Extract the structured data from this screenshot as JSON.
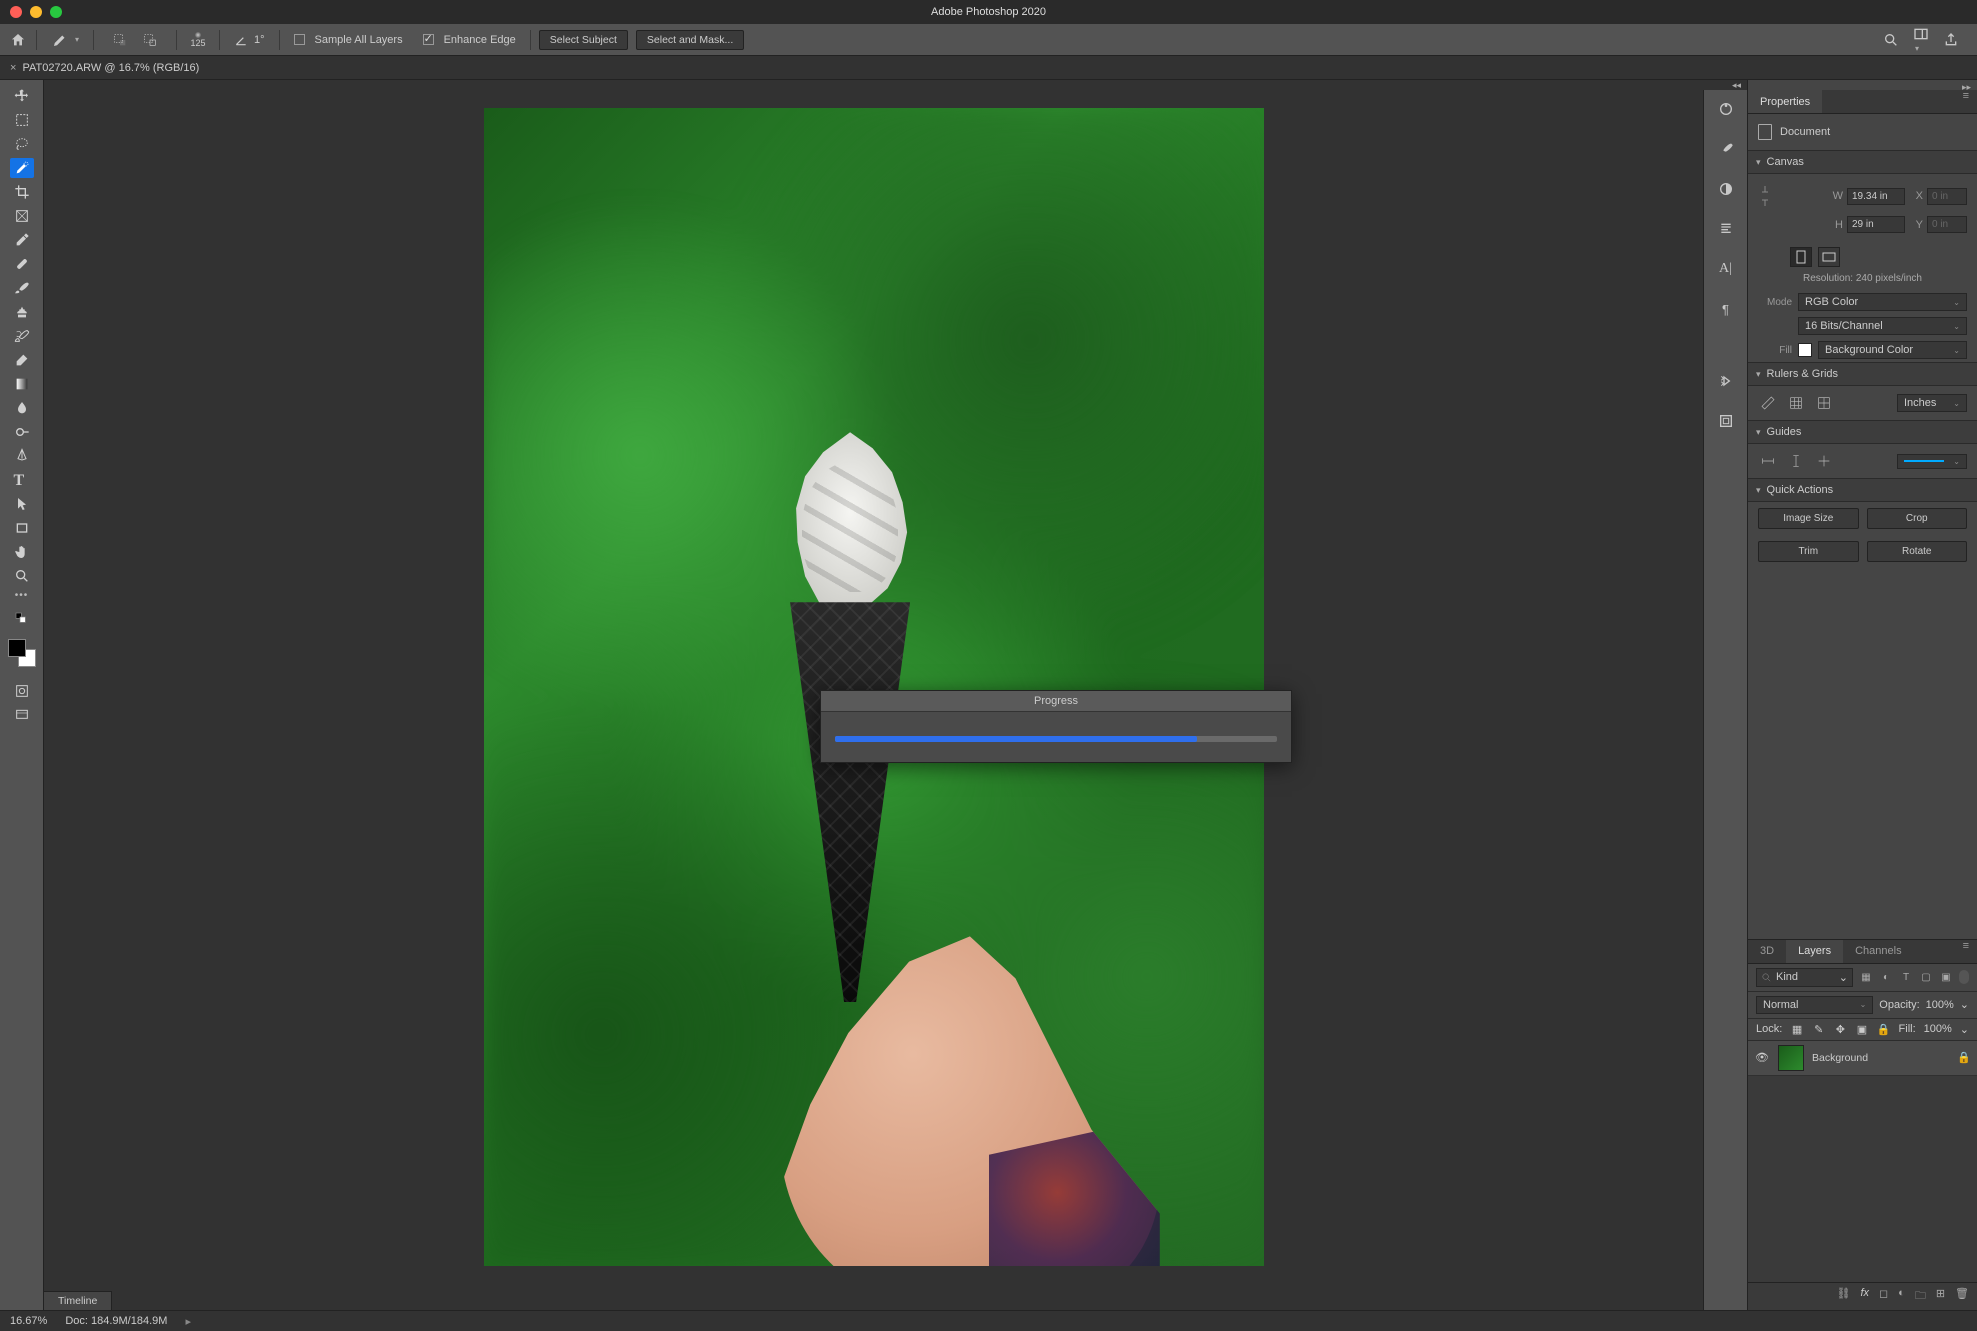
{
  "app_title": "Adobe Photoshop 2020",
  "document_tab": "PAT02720.ARW @ 16.7% (RGB/16)",
  "options_bar": {
    "brush_size": "125",
    "angle_label": "1°",
    "sample_all_layers": "Sample All Layers",
    "sample_all_layers_checked": false,
    "enhance_edge": "Enhance Edge",
    "enhance_edge_checked": true,
    "select_subject": "Select Subject",
    "select_and_mask": "Select and Mask..."
  },
  "progress_dialog": {
    "title": "Progress",
    "percent": 82
  },
  "properties": {
    "tab": "Properties",
    "doc_label": "Document",
    "sections": {
      "canvas": "Canvas",
      "rulers": "Rulers & Grids",
      "guides": "Guides",
      "quick": "Quick Actions"
    },
    "canvas": {
      "w_label": "W",
      "w_value": "19.34 in",
      "h_label": "H",
      "h_value": "29 in",
      "x_label": "X",
      "x_value": "0 in",
      "y_label": "Y",
      "y_value": "0 in",
      "resolution": "Resolution: 240 pixels/inch",
      "mode_label": "Mode",
      "mode_value": "RGB Color",
      "depth_value": "16 Bits/Channel",
      "fill_label": "Fill",
      "fill_value": "Background Color"
    },
    "rulers": {
      "units": "Inches"
    },
    "quick_actions": {
      "image_size": "Image Size",
      "crop": "Crop",
      "trim": "Trim",
      "rotate": "Rotate"
    }
  },
  "layers_panel": {
    "tabs": {
      "3d": "3D",
      "layers": "Layers",
      "channels": "Channels"
    },
    "kind_placeholder": "Kind",
    "blend_mode": "Normal",
    "opacity_label": "Opacity:",
    "opacity_value": "100%",
    "lock_label": "Lock:",
    "fill_label": "Fill:",
    "fill_value": "100%",
    "layer": {
      "name": "Background"
    }
  },
  "status_bar": {
    "zoom": "16.67%",
    "doc_info": "Doc: 184.9M/184.9M"
  },
  "timeline": "Timeline"
}
